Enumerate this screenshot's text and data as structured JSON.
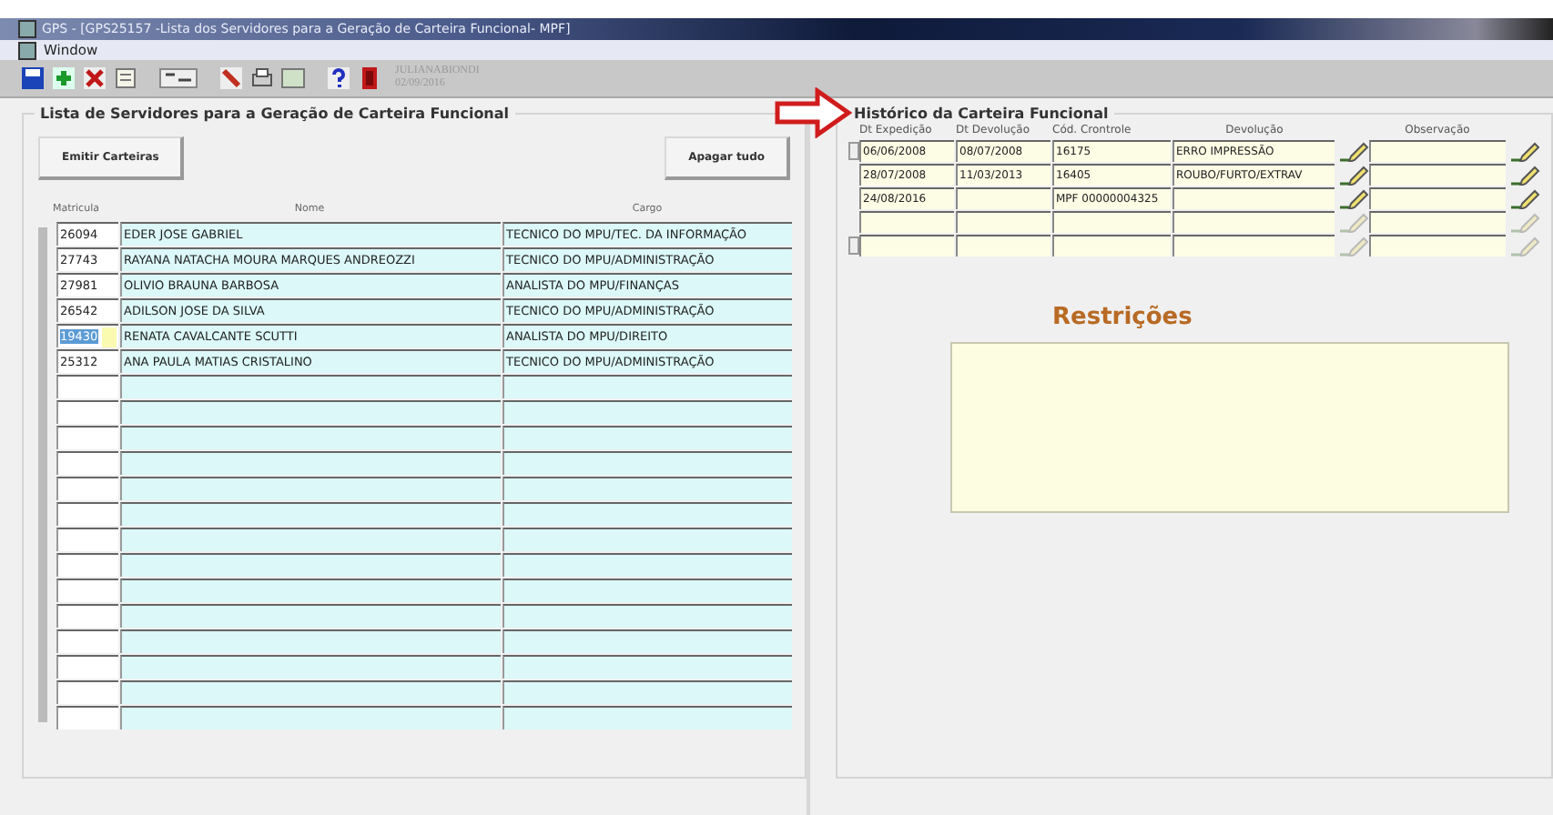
{
  "window": {
    "title": "GPS - [GPS25157 -Lista dos Servidores para a Geração de Carteira Funcional- MPF]"
  },
  "menu": [
    "Window"
  ],
  "toolbar": {
    "user": "JULIANABIONDI",
    "date": "02/09/2016"
  },
  "servidores": {
    "title": "Lista de Servidores para a Geração de Carteira Funcional",
    "buttons": [
      "Emitir Carteiras",
      "Apagar tudo"
    ],
    "columns": [
      "Matricula",
      "Nome",
      "Cargo"
    ],
    "rows": [
      {
        "matricula": "26094",
        "nome": "EDER JOSE GABRIEL",
        "cargo": "TECNICO DO MPU/TEC. DA INFORMAÇÃO",
        "selected": false
      },
      {
        "matricula": "27743",
        "nome": "RAYANA NATACHA MOURA MARQUES ANDREOZZI",
        "cargo": "TECNICO DO MPU/ADMINISTRAÇÃO",
        "selected": false
      },
      {
        "matricula": "27981",
        "nome": "OLIVIO BRAUNA BARBOSA",
        "cargo": "ANALISTA DO MPU/FINANÇAS",
        "selected": false
      },
      {
        "matricula": "26542",
        "nome": "ADILSON JOSE DA SILVA",
        "cargo": "TECNICO DO MPU/ADMINISTRAÇÃO",
        "selected": false
      },
      {
        "matricula": "19430",
        "nome": "RENATA CAVALCANTE SCUTTI",
        "cargo": "ANALISTA DO MPU/DIREITO",
        "selected": true
      },
      {
        "matricula": "25312",
        "nome": "ANA PAULA MATIAS CRISTALINO",
        "cargo": "TECNICO DO MPU/ADMINISTRAÇÃO",
        "selected": false
      },
      {
        "selected": false
      },
      {
        "selected": false
      },
      {
        "selected": false
      },
      {
        "selected": false
      },
      {
        "selected": false
      },
      {
        "selected": false
      },
      {
        "selected": false
      },
      {
        "selected": false
      },
      {
        "selected": false
      },
      {
        "selected": false
      },
      {
        "selected": false
      },
      {
        "selected": false
      },
      {
        "selected": false
      },
      {
        "selected": false
      }
    ]
  },
  "historico": {
    "title": "Histórico da Carteira Funcional",
    "columns": [
      "Dt Expedição",
      "Dt Devolução",
      "Cód. Crontrole",
      "Devolução",
      "Observação"
    ],
    "rows": [
      {
        "cells": [
          "06/06/2008",
          "08/07/2008",
          "16175",
          "ERRO IMPRESSÃO",
          ""
        ],
        "enabled": true
      },
      {
        "cells": [
          "28/07/2008",
          "11/03/2013",
          "16405",
          "ROUBO/FURTO/EXTRAV",
          ""
        ],
        "enabled": true
      },
      {
        "cells": [
          "24/08/2016",
          "",
          "MPF 00000004325",
          "",
          ""
        ],
        "enabled": true
      },
      {
        "cells": [
          "",
          "",
          "",
          "",
          ""
        ],
        "enabled": false
      },
      {
        "cells": [
          "",
          "",
          "",
          "",
          ""
        ],
        "enabled": false
      }
    ]
  },
  "restricoes": {
    "title": "Restrições"
  }
}
